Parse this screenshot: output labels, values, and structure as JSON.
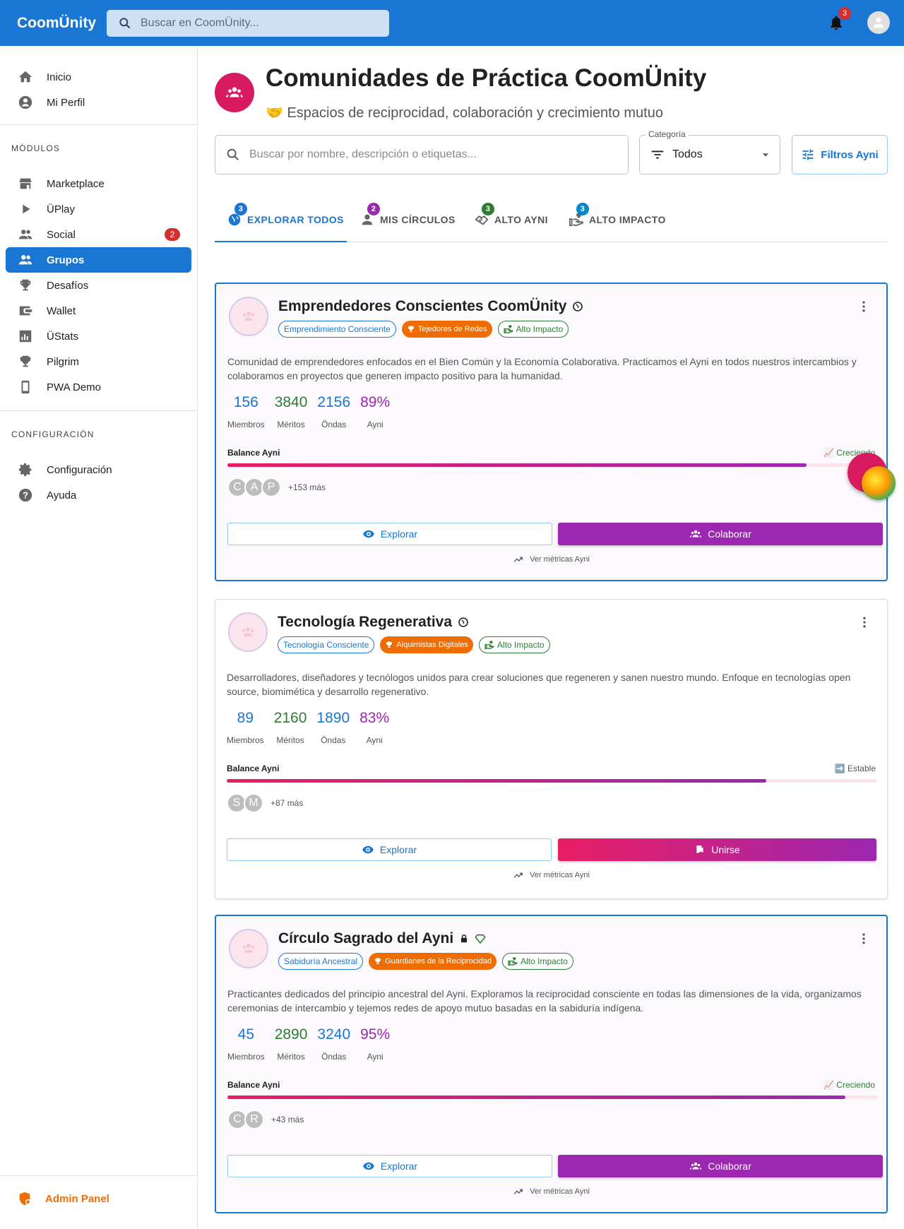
{
  "app": {
    "logo": "CoomÜnity",
    "search_placeholder": "Buscar en CoomÜnity...",
    "notifications": "3"
  },
  "sidebar": {
    "items": [
      {
        "label": "Inicio",
        "icon": "home-icon"
      },
      {
        "label": "Mi Perfil",
        "icon": "account-icon"
      }
    ],
    "modules_title": "MÓDULOS",
    "modules": [
      {
        "label": "Marketplace",
        "icon": "store-icon"
      },
      {
        "label": "ÜPlay",
        "icon": "play-icon"
      },
      {
        "label": "Social",
        "icon": "people-icon",
        "badge": "2"
      },
      {
        "label": "Grupos",
        "icon": "groups-icon"
      },
      {
        "label": "Desafíos",
        "icon": "trophy-icon"
      },
      {
        "label": "Wallet",
        "icon": "wallet-icon"
      },
      {
        "label": "ÜStats",
        "icon": "stats-icon"
      },
      {
        "label": "Pilgrim",
        "icon": "trophy-icon"
      },
      {
        "label": "PWA Demo",
        "icon": "phone-icon"
      }
    ],
    "config_title": "CONFIGURACIÓN",
    "config": [
      {
        "label": "Configuración",
        "icon": "gear-icon"
      },
      {
        "label": "Ayuda",
        "icon": "help-icon"
      }
    ],
    "admin": "Admin Panel"
  },
  "page": {
    "title": "Comunidades de Práctica CoomÜnity",
    "subtitle": "🤝 Espacios de reciprocidad, colaboración y crecimiento mutuo",
    "search_placeholder": "Buscar por nombre, descripción o etiquetas...",
    "category_label": "Categoría",
    "category_value": "Todos",
    "filters_button": "Filtros Ayni"
  },
  "tabs": [
    {
      "label": "EXPLORAR TODOS",
      "badge": "3",
      "color": "#1976d2"
    },
    {
      "label": "MIS CÍRCULOS",
      "badge": "2",
      "color": "#9c27b0"
    },
    {
      "label": "ALTO AYNI",
      "badge": "3",
      "color": "#2e7d32"
    },
    {
      "label": "ALTO IMPACTO",
      "badge": "3",
      "color": "#0288d1"
    }
  ],
  "cards": [
    {
      "title": "Emprendedores Conscientes CoomÜnity",
      "chips": [
        "Emprendimiento Consciente",
        "Tejedores de Redes",
        "Alto Impacto"
      ],
      "description": "Comunidad de emprendedores enfocados en el Bien Común y la Economía Colaborativa. Practicamos el Ayni en todos nuestros intercambios y colaboramos en proyectos que generen impacto positivo para la humanidad.",
      "stats": [
        {
          "value": "156",
          "label": "Miembros"
        },
        {
          "value": "3840",
          "label": "Méritos"
        },
        {
          "value": "2156",
          "label": "Öndas"
        },
        {
          "value": "89%",
          "label": "Ayni"
        }
      ],
      "balance_label": "Balance Ayni",
      "trend": "📈 Creciendo",
      "balance": 0.89,
      "members": [
        "C",
        "A",
        "P"
      ],
      "more": "+153 más",
      "explore": "Explorar",
      "action": "Colaborar",
      "metrics": "Ver métricas Ayni"
    },
    {
      "title": "Tecnología Regenerativa",
      "chips": [
        "Tecnología Consciente",
        "Alquimistas Digitales",
        "Alto Impacto"
      ],
      "description": "Desarrolladores, diseñadores y tecnólogos unidos para crear soluciones que regeneren y sanen nuestro mundo. Enfoque en tecnologías open source, biomimética y desarrollo regenerativo.",
      "stats": [
        {
          "value": "89",
          "label": "Miembros"
        },
        {
          "value": "2160",
          "label": "Méritos"
        },
        {
          "value": "1890",
          "label": "Öndas"
        },
        {
          "value": "83%",
          "label": "Ayni"
        }
      ],
      "balance_label": "Balance Ayni",
      "trend": "➡️ Estable",
      "balance": 0.83,
      "members": [
        "S",
        "M"
      ],
      "more": "+87 más",
      "explore": "Explorar",
      "action": "Unirse",
      "metrics": "Ver métricas Ayni"
    },
    {
      "title": "Círculo Sagrado del Ayni",
      "chips": [
        "Sabiduría Ancestral",
        "Guardianes de la Reciprocidad",
        "Alto Impacto"
      ],
      "description": "Practicantes dedicados del principio ancestral del Ayni. Exploramos la reciprocidad consciente en todas las dimensiones de la vida, organizamos ceremonias de intercambio y tejemos redes de apoyo mutuo basadas en la sabiduría indígena.",
      "stats": [
        {
          "value": "45",
          "label": "Miembros"
        },
        {
          "value": "2890",
          "label": "Méritos"
        },
        {
          "value": "3240",
          "label": "Öndas"
        },
        {
          "value": "95%",
          "label": "Ayni"
        }
      ],
      "balance_label": "Balance Ayni",
      "trend": "📈 Creciendo",
      "balance": 0.95,
      "members": [
        "C",
        "R"
      ],
      "more": "+43 más",
      "explore": "Explorar",
      "action": "Colaborar",
      "metrics": "Ver métricas Ayni"
    }
  ],
  "colors": {
    "primary": "#1976d2",
    "purple": "#9c27b0",
    "pink": "#e91e63",
    "green": "#2e7d32",
    "orange": "#ef6c00"
  }
}
